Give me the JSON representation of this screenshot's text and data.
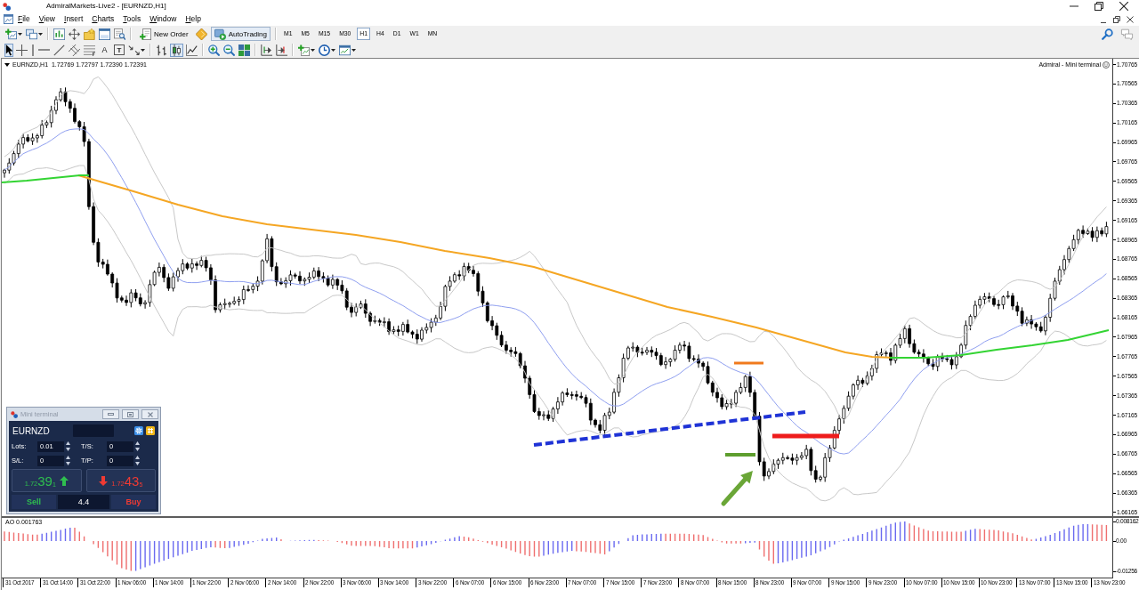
{
  "window": {
    "title": "AdmiralMarkets-Live2 - [EURNZD,H1]"
  },
  "menu": [
    "File",
    "View",
    "Insert",
    "Charts",
    "Tools",
    "Window",
    "Help"
  ],
  "toolbar": {
    "new_order": "New Order",
    "auto_trading": {
      "label": "AutoTrading",
      "on": true
    },
    "timeframes": [
      {
        "label": "M1",
        "selected": false
      },
      {
        "label": "M5",
        "selected": false
      },
      {
        "label": "M15",
        "selected": false
      },
      {
        "label": "M30",
        "selected": false
      },
      {
        "label": "H1",
        "selected": true
      },
      {
        "label": "H4",
        "selected": false
      },
      {
        "label": "D1",
        "selected": false
      },
      {
        "label": "W1",
        "selected": false
      },
      {
        "label": "MN",
        "selected": false
      }
    ]
  },
  "drawing_toolbar": {
    "tools": [
      {
        "kind": "icon",
        "selected": true
      },
      {
        "kind": "icon",
        "selected": false
      },
      {
        "kind": "icon",
        "selected": false
      },
      {
        "kind": "icon",
        "selected": false
      },
      {
        "kind": "icon",
        "selected": false
      },
      {
        "kind": "icon",
        "selected": false
      },
      {
        "kind": "icon",
        "selected": false
      },
      {
        "kind": "text",
        "glyph": "A",
        "selected": false
      },
      {
        "kind": "label",
        "glyph": "T",
        "selected": false
      },
      {
        "kind": "icon",
        "selected": false
      }
    ],
    "chart_types": [
      {
        "selected": false
      },
      {
        "selected": true
      },
      {
        "selected": false
      }
    ]
  },
  "chart": {
    "header": "EURNZD,H1  1.72769 1.72797 1.72390 1.72391",
    "expert": "Admiral - Mini terminal",
    "price_axis": [
      "1.70765",
      "1.70565",
      "1.70365",
      "1.70165",
      "1.69965",
      "1.69765",
      "1.69565",
      "1.69365",
      "1.69165",
      "1.68965",
      "1.68765",
      "1.68565",
      "1.68365",
      "1.68165",
      "1.67965",
      "1.67765",
      "1.67565",
      "1.67365",
      "1.67165",
      "1.66965",
      "1.66765",
      "1.66565",
      "1.66365",
      "1.66165"
    ],
    "indicator": {
      "label": "AO 0.001763",
      "axis": [
        "0.008162",
        "0.00",
        "-0.01256"
      ]
    },
    "time_axis": [
      "31 Oct 2017",
      "31 Oct 14:00",
      "31 Oct 22:00",
      "1 Nov 06:00",
      "1 Nov 14:00",
      "1 Nov 22:00",
      "2 Nov 06:00",
      "2 Nov 14:00",
      "2 Nov 22:00",
      "3 Nov 06:00",
      "3 Nov 14:00",
      "3 Nov 22:00",
      "6 Nov 07:00",
      "6 Nov 15:00",
      "6 Nov 23:00",
      "7 Nov 07:00",
      "7 Nov 15:00",
      "7 Nov 23:00",
      "8 Nov 07:00",
      "8 Nov 15:00",
      "8 Nov 23:00",
      "9 Nov 07:00",
      "9 Nov 15:00",
      "9 Nov 23:00",
      "10 Nov 07:00",
      "10 Nov 15:00",
      "10 Nov 23:00",
      "13 Nov 07:00",
      "13 Nov 15:00",
      "13 Nov 23:00"
    ]
  },
  "mini_terminal": {
    "title": "Mini terminal",
    "symbol": "EURNZD",
    "fields": [
      {
        "label": "Lots:",
        "value": "0.01"
      },
      {
        "label": "T/S:",
        "value": "0"
      },
      {
        "label": "S/L:",
        "value": "0"
      },
      {
        "label": "T/P:",
        "value": "0"
      }
    ],
    "sell": {
      "label": "Sell",
      "price": {
        "prefix": "1.72",
        "pips": "39",
        "point": "1"
      },
      "rising": true
    },
    "buy": {
      "label": "Buy",
      "price": {
        "prefix": "1.72",
        "pips": "43",
        "point": "5"
      },
      "rising": false
    },
    "spread": "4.4"
  }
}
